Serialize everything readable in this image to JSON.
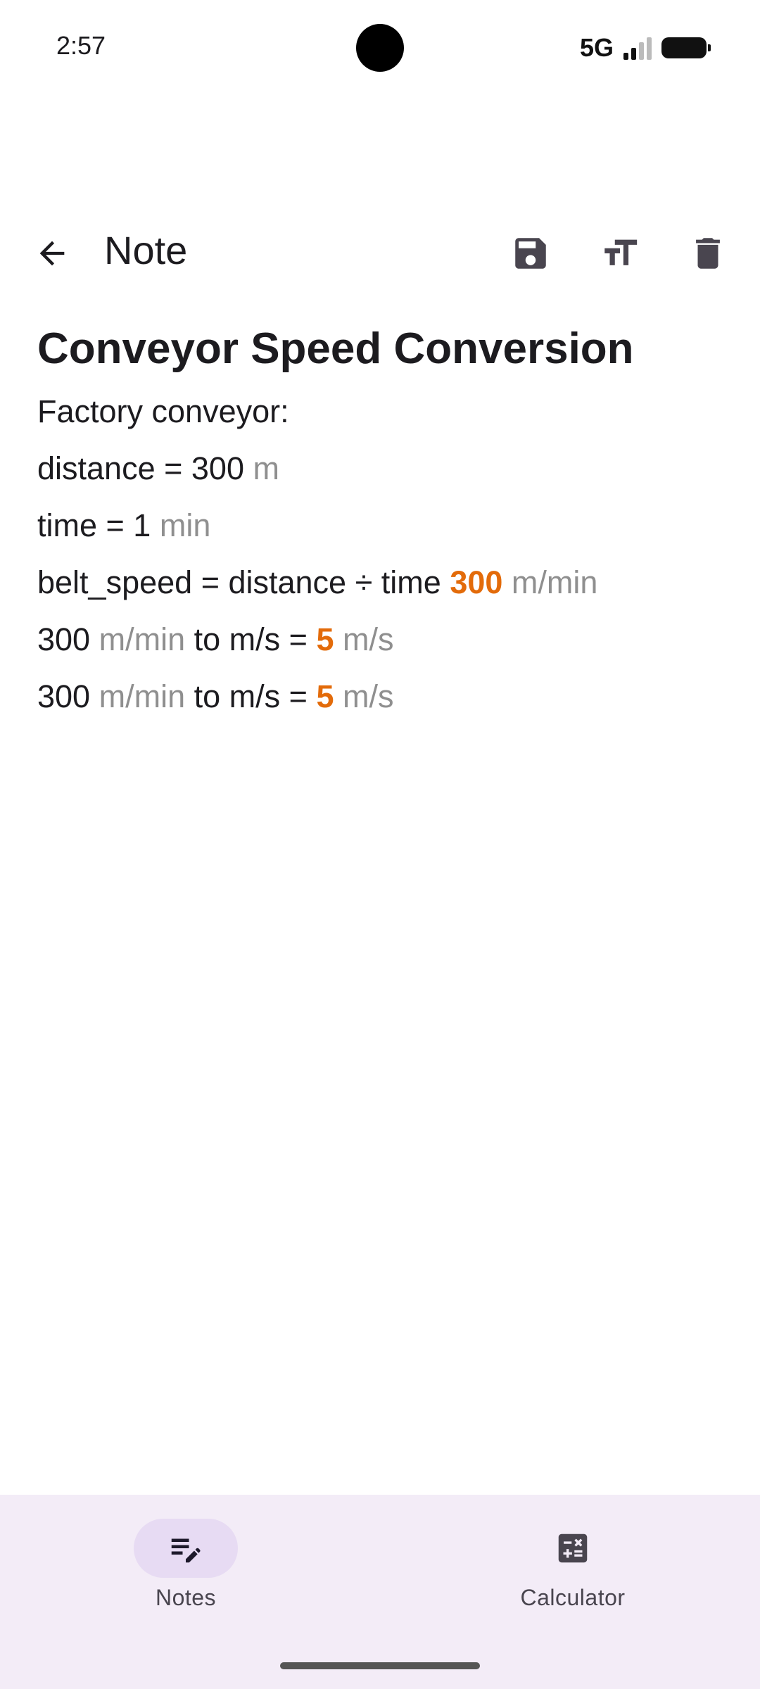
{
  "status_bar": {
    "time": "2:57",
    "network": "5G"
  },
  "app_bar": {
    "title": "Note",
    "icons": {
      "back": "arrow-back-icon",
      "save": "save-icon",
      "text_size": "text-size-icon",
      "delete": "delete-icon"
    }
  },
  "note": {
    "title": "Conveyor Speed Conversion",
    "lines": [
      {
        "text": "Factory conveyor:"
      },
      {
        "text": "distance = 300",
        "unit": "m"
      },
      {
        "text": "time = 1",
        "unit": "min"
      },
      {
        "text": "belt_speed = distance ÷ time",
        "result": "300",
        "result_unit": "m/min"
      },
      {
        "value": "300",
        "unit": "m/min",
        "text": "to m/s =",
        "result": "5",
        "result_unit": "m/s"
      },
      {
        "value": "300",
        "unit": "m/min",
        "text": "to m/s =",
        "result": "5",
        "result_unit": "m/s"
      }
    ]
  },
  "bottom_nav": {
    "items": [
      {
        "label": "Notes",
        "icon": "notes-edit-icon",
        "active": true
      },
      {
        "label": "Calculator",
        "icon": "calculator-icon",
        "active": false
      }
    ]
  },
  "colors": {
    "result": "#e36b0a",
    "unit": "#8f8f8f",
    "nav_background": "#f3ecf7",
    "nav_active_pill": "#e7dbf3"
  }
}
